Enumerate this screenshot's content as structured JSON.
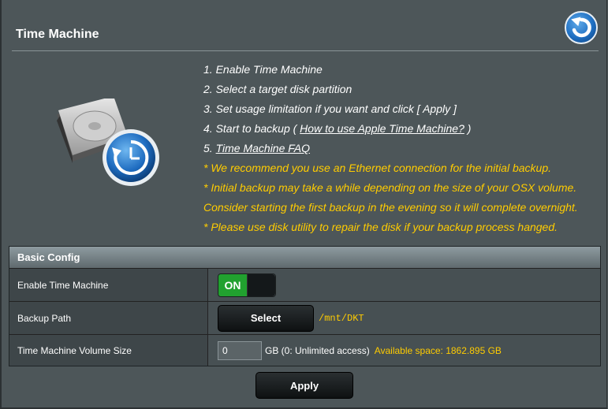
{
  "page": {
    "title": "Time Machine"
  },
  "instructions": {
    "steps": [
      "1. Enable Time Machine",
      "2. Select a target disk partition",
      "3. Set usage limitation if you want and click [ Apply ]"
    ],
    "step4_prefix": "4. Start to backup ( ",
    "step4_link": "How to use Apple Time Machine?",
    "step4_suffix": " )",
    "step5_prefix": "5. ",
    "step5_link": "Time Machine FAQ",
    "notes": [
      "* We recommend you use an Ethernet connection for the initial backup.",
      "* Initial backup may take a while depending on the size of your OSX volume.",
      "Consider starting the first backup in the evening so it will complete overnight.",
      "* Please use disk utility to repair the disk if your backup process hanged."
    ]
  },
  "config": {
    "header": "Basic Config",
    "enable_label": "Enable Time Machine",
    "toggle_on_text": "ON",
    "backup_path_label": "Backup Path",
    "select_button": "Select",
    "backup_path_value": "/mnt/DKT",
    "volume_size_label": "Time Machine Volume Size",
    "volume_size_value": "0",
    "volume_unit_text": "GB (0: Unlimited access)",
    "available_space": "Available space: 1862.895 GB"
  },
  "apply_button": "Apply",
  "colors": {
    "accent_yellow": "#ffcc00",
    "toggle_green": "#21a12f",
    "background": "#4d5659"
  },
  "icons": {
    "back": "back-arrow-icon",
    "disk": "hard-disk-time-machine-icon"
  }
}
